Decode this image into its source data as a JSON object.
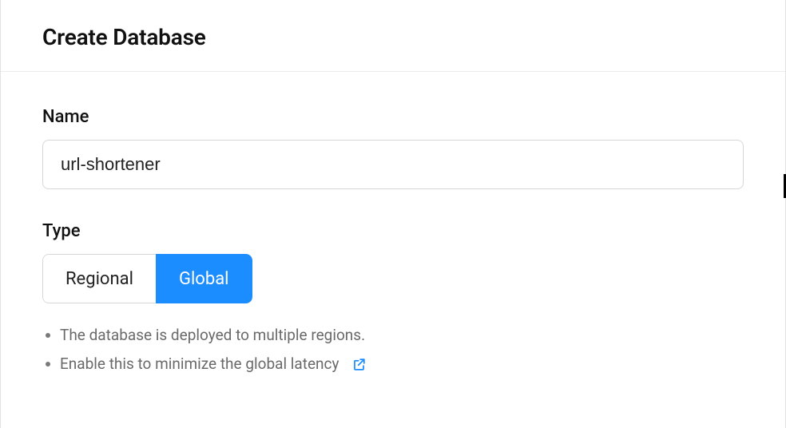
{
  "header": {
    "title": "Create Database"
  },
  "form": {
    "name": {
      "label": "Name",
      "value": "url-shortener"
    },
    "type": {
      "label": "Type",
      "options": [
        "Regional",
        "Global"
      ],
      "selected": "Global",
      "hints": [
        "The database is deployed to multiple regions.",
        "Enable this to minimize the global latency"
      ]
    }
  },
  "icons": {
    "external_link": "external-link-icon"
  }
}
